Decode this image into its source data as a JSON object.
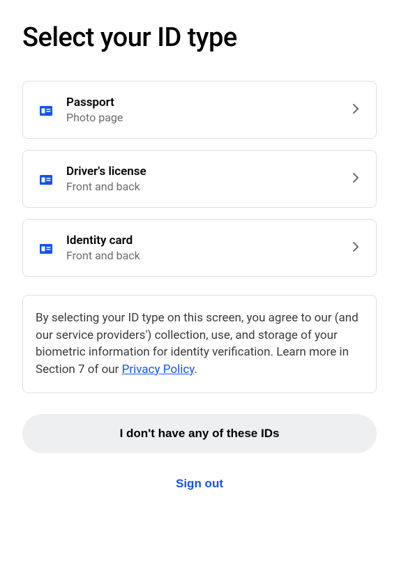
{
  "title": "Select your ID type",
  "options": [
    {
      "title": "Passport",
      "subtitle": "Photo page"
    },
    {
      "title": "Driver's license",
      "subtitle": "Front and back"
    },
    {
      "title": "Identity card",
      "subtitle": "Front and back"
    }
  ],
  "disclosure": {
    "text_before": "By selecting your ID type on this screen, you agree to our (and our service providers') collection, use, and storage of your biometric information for identity verification. Learn more in Section 7 of our ",
    "link_text": "Privacy Policy",
    "text_after": "."
  },
  "no_id_button": "I don't have any of these IDs",
  "sign_out": "Sign out"
}
